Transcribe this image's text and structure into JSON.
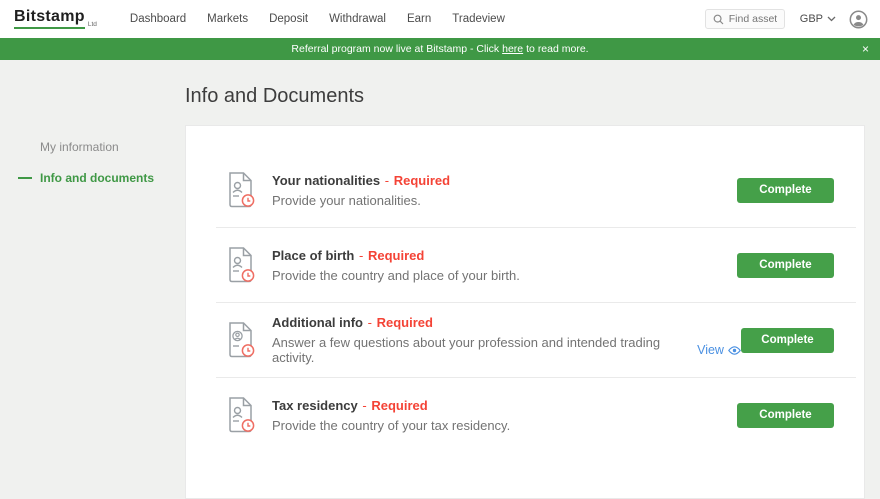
{
  "brand": {
    "name": "Bitstamp",
    "suffix": "Ltd"
  },
  "nav": {
    "items": [
      "Dashboard",
      "Markets",
      "Deposit",
      "Withdrawal",
      "Earn",
      "Tradeview"
    ]
  },
  "topbar": {
    "search_placeholder": "Find asset",
    "currency": "GBP",
    "icons": {
      "search": "magnifier",
      "currency": "chevron-down",
      "account": "avatar-circle"
    }
  },
  "banner": {
    "text_before": "Referral program now live at Bitstamp - Click",
    "link_label": "here",
    "text_after": "to read more.",
    "close_label": "×",
    "bg_color": "#3f9845"
  },
  "page": {
    "title": "Info and Documents"
  },
  "sidebar": {
    "items": [
      {
        "label": "My information",
        "active": false
      },
      {
        "label": "Info and documents",
        "active": true
      }
    ]
  },
  "labels": {
    "separator": "-"
  },
  "tasks": [
    {
      "title": "Your nationalities",
      "required": "Required",
      "description": "Provide your nationalities.",
      "action": "Complete",
      "icon": "document-person-pending"
    },
    {
      "title": "Place of birth",
      "required": "Required",
      "description": "Provide the country and place of your birth.",
      "action": "Complete",
      "icon": "document-person-pending"
    },
    {
      "title": "Additional info",
      "required": "Required",
      "description": "Answer a few questions about your profession and intended trading activity.",
      "view_label": "View",
      "view_icon": "eye",
      "action": "Complete",
      "icon": "document-person-pending"
    },
    {
      "title": "Tax residency",
      "required": "Required",
      "description": "Provide the country of your tax residency.",
      "action": "Complete",
      "icon": "document-person-pending"
    }
  ],
  "colors": {
    "accent_green": "#3f9845",
    "button_green": "#45a049",
    "required_red": "#f44336",
    "badge_red": "#ef6e63",
    "link_blue": "#4a90e2",
    "page_bg": "#f0f1ef"
  }
}
